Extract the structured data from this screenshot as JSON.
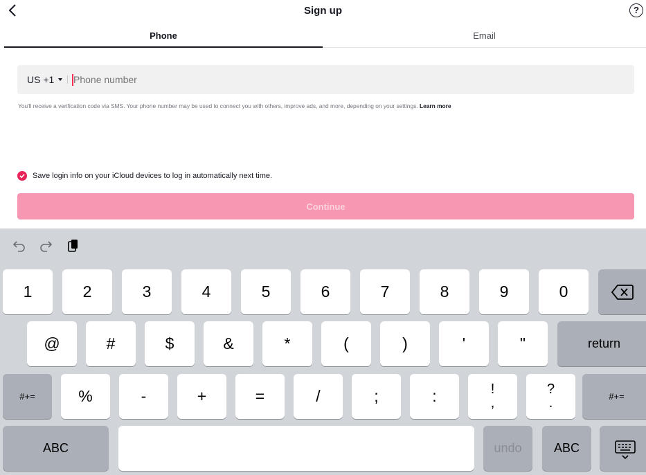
{
  "header": {
    "title": "Sign up",
    "help_label": "?"
  },
  "tabs": [
    {
      "label": "Phone",
      "active": true
    },
    {
      "label": "Email",
      "active": false
    }
  ],
  "phone_field": {
    "country_code": "US +1",
    "placeholder": "Phone number",
    "value": ""
  },
  "notice": {
    "text": "You'll receive a verification code via SMS. Your phone number may be used to connect you with others, improve ads, and more, depending on your settings.",
    "link": "Learn more"
  },
  "save_login": {
    "label": "Save login info on your iCloud devices to log in automatically next time.",
    "checked": true
  },
  "continue_button": {
    "label": "Continue",
    "enabled": false
  },
  "colors": {
    "accent": "#fe2c55",
    "checkbox": "#e8245a",
    "continue_disabled": "#f797b1",
    "keyboard_bg": "#d1d4d9"
  },
  "keyboard": {
    "toolbar": [
      "undo-icon",
      "redo-icon",
      "paste-icon"
    ],
    "row1": [
      "1",
      "2",
      "3",
      "4",
      "5",
      "6",
      "7",
      "8",
      "9",
      "0"
    ],
    "row1_end": "backspace-icon",
    "row2": [
      "@",
      "#",
      "$",
      "&",
      "*",
      "(",
      ")",
      "'",
      "\""
    ],
    "return_label": "return",
    "row3_left": "#+=",
    "row3": [
      "%",
      "-",
      "+",
      "=",
      "/",
      ";",
      ":",
      "!,",
      "?."
    ],
    "row3_right": "#+=",
    "row4": {
      "abc_left": "ABC",
      "undo": "undo",
      "abc_right": "ABC",
      "hide": "keyboard-icon"
    }
  }
}
